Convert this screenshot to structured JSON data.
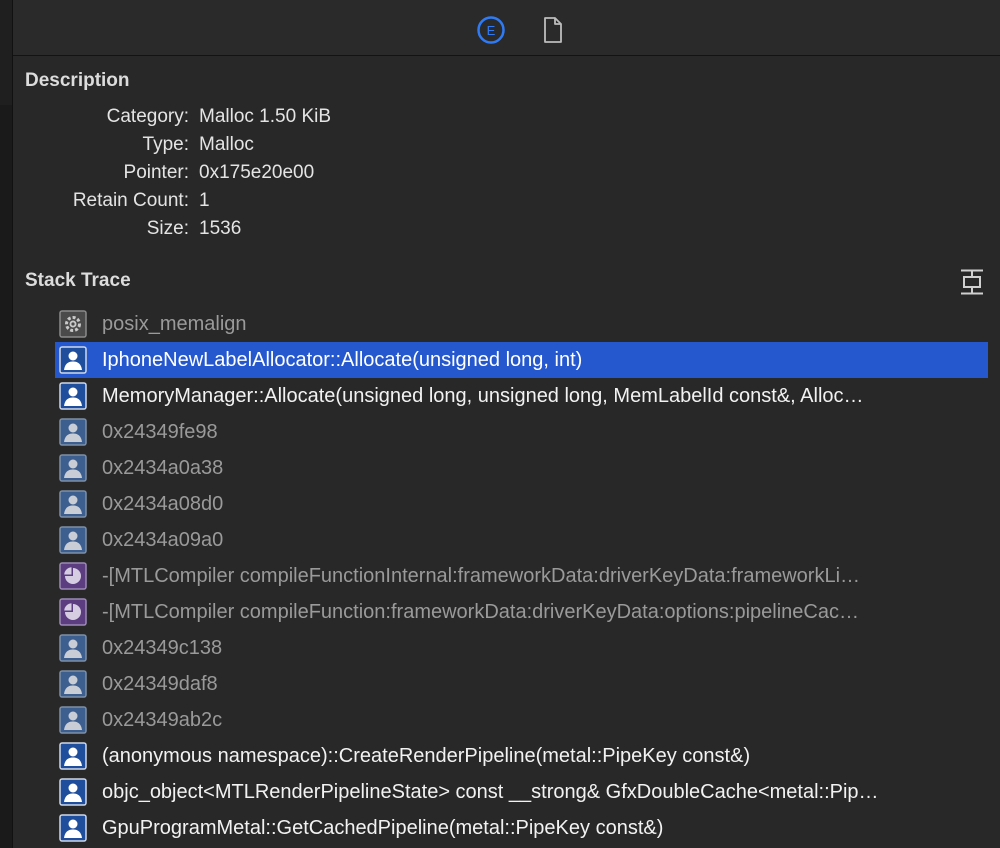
{
  "toolbar": {
    "extended_icon_letter": "E",
    "icons": [
      "extended-detail-icon",
      "document-icon"
    ]
  },
  "description": {
    "title": "Description",
    "fields": [
      {
        "label": "Category:",
        "value": "Malloc 1.50 KiB"
      },
      {
        "label": "Type:",
        "value": "Malloc"
      },
      {
        "label": "Pointer:",
        "value": "0x175e20e00"
      },
      {
        "label": "Retain Count:",
        "value": "1"
      },
      {
        "label": "Size:",
        "value": "1536"
      }
    ]
  },
  "stack_trace": {
    "title": "Stack Trace",
    "frames": [
      {
        "label": "posix_memalign",
        "icon": "gear-icon",
        "style": "dim"
      },
      {
        "label": "IphoneNewLabelAllocator::Allocate(unsigned long, int)",
        "icon": "user-icon",
        "style": "selected"
      },
      {
        "label": "MemoryManager::Allocate(unsigned long, unsigned long, MemLabelId const&, Alloc…",
        "icon": "user-icon",
        "style": "bright"
      },
      {
        "label": "0x24349fe98",
        "icon": "user-icon",
        "style": "dim"
      },
      {
        "label": "0x2434a0a38",
        "icon": "user-icon",
        "style": "dim"
      },
      {
        "label": "0x2434a08d0",
        "icon": "user-icon",
        "style": "dim"
      },
      {
        "label": "0x2434a09a0",
        "icon": "user-icon",
        "style": "dim"
      },
      {
        "label": "-[MTLCompiler compileFunctionInternal:frameworkData:driverKeyData:frameworkLi…",
        "icon": "framework-icon",
        "style": "dim"
      },
      {
        "label": "-[MTLCompiler compileFunction:frameworkData:driverKeyData:options:pipelineCac…",
        "icon": "framework-icon",
        "style": "dim"
      },
      {
        "label": "0x24349c138",
        "icon": "user-icon",
        "style": "dim"
      },
      {
        "label": "0x24349daf8",
        "icon": "user-icon",
        "style": "dim"
      },
      {
        "label": "0x24349ab2c",
        "icon": "user-icon",
        "style": "dim"
      },
      {
        "label": "(anonymous namespace)::CreateRenderPipeline(metal::PipeKey const&)",
        "icon": "user-icon",
        "style": "bright"
      },
      {
        "label": "objc_object<MTLRenderPipelineState> const __strong& GfxDoubleCache<metal::Pip…",
        "icon": "user-icon",
        "style": "bright"
      },
      {
        "label": "GpuProgramMetal::GetCachedPipeline(metal::PipeKey const&)",
        "icon": "user-icon",
        "style": "bright"
      }
    ]
  },
  "colors": {
    "background": "#282828",
    "selection": "#2557cf",
    "accent_blue": "#2f7bf5",
    "user_frame_icon": "#1f4e9c",
    "framework_frame_icon": "#5b3d80"
  }
}
